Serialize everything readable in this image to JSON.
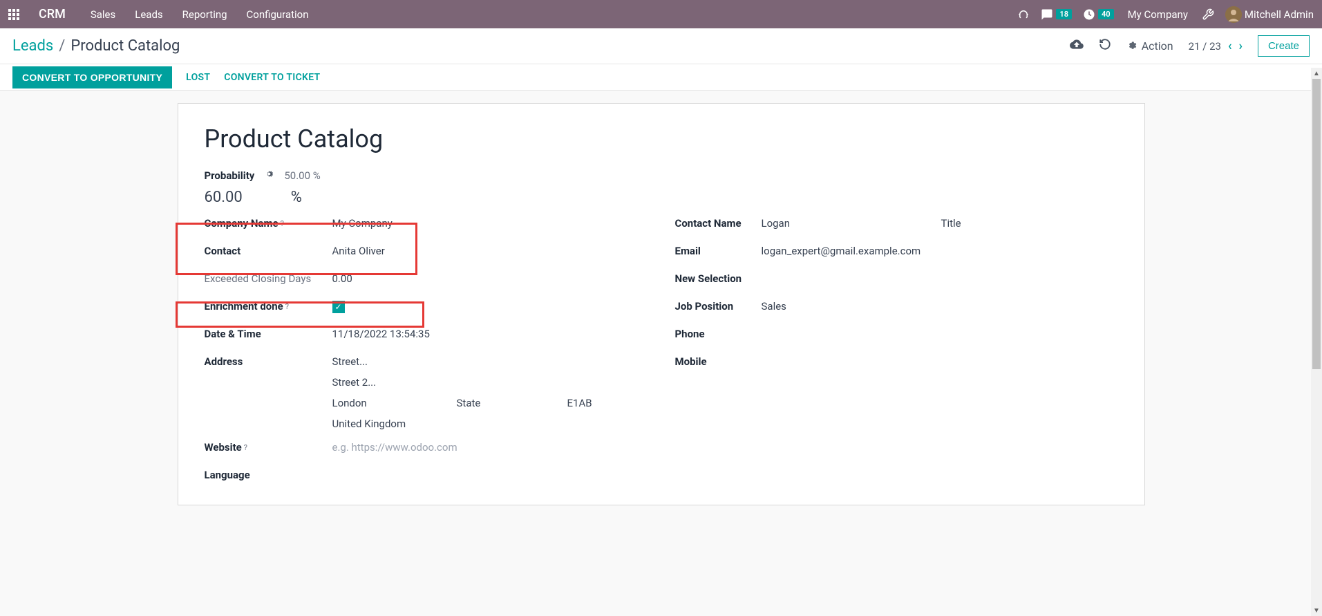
{
  "topnav": {
    "brand": "CRM",
    "menu": [
      "Sales",
      "Leads",
      "Reporting",
      "Configuration"
    ],
    "messages_badge": "18",
    "activities_badge": "40",
    "company": "My Company",
    "user": "Mitchell Admin"
  },
  "breadcrumb": {
    "parent": "Leads",
    "current": "Product Catalog"
  },
  "toolbar": {
    "action_label": "Action",
    "pager": "21 / 23",
    "create_label": "Create"
  },
  "statusbar": {
    "convert_opp": "CONVERT TO OPPORTUNITY",
    "lost": "LOST",
    "convert_ticket": "CONVERT TO TICKET"
  },
  "record": {
    "title": "Product Catalog",
    "probability_label": "Probability",
    "probability_default": "50.00 %",
    "probability_value": "60.00",
    "probability_unit": "%",
    "left": {
      "company_name_label": "Company Name",
      "company_name_value": "My Company",
      "contact_label": "Contact",
      "contact_value": "Anita Oliver",
      "exceeded_label": "Exceeded Closing Days",
      "exceeded_value": "0.00",
      "enrichment_label": "Enrichment done",
      "datetime_label": "Date & Time",
      "datetime_value": "11/18/2022 13:54:35",
      "address_label": "Address",
      "street_ph": "Street...",
      "street2_ph": "Street 2...",
      "city": "London",
      "state_ph": "State",
      "zip": "E1AB",
      "country": "United Kingdom",
      "website_label": "Website",
      "website_ph": "e.g. https://www.odoo.com",
      "language_label": "Language"
    },
    "right": {
      "contact_name_label": "Contact Name",
      "contact_name_value": "Logan",
      "title_ph": "Title",
      "email_label": "Email",
      "email_value": "logan_expert@gmail.example.com",
      "new_selection_label": "New Selection",
      "job_label": "Job Position",
      "job_value": "Sales",
      "phone_label": "Phone",
      "mobile_label": "Mobile"
    }
  }
}
